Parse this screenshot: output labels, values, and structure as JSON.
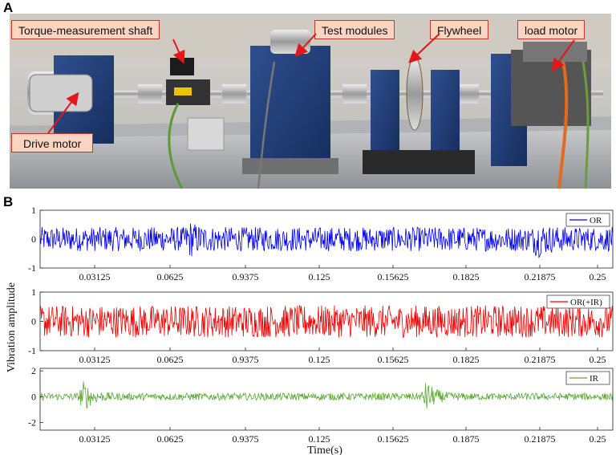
{
  "panels": {
    "a": "A",
    "b": "B"
  },
  "callouts": {
    "torque": "Torque-measurement shaft",
    "test_modules": "Test modules",
    "flywheel": "Flywheel",
    "load_motor": "load motor",
    "drive_motor": "Drive motor"
  },
  "colors": {
    "callout_fill": "#fbd5c1",
    "callout_border": "#c0392b",
    "arrow": "#e3161b",
    "or": "#0000ee",
    "or_ir": "#ee0000",
    "ir": "#5aa832"
  },
  "chart_data": [
    {
      "type": "line",
      "series": [
        {
          "name": "OR",
          "color": "#0000ee"
        }
      ],
      "ylim": [
        -1,
        1
      ],
      "yticks": [
        "1",
        "0",
        "-1"
      ],
      "xticks": [
        "0.03125",
        "0.0625",
        "0.9375",
        "0.125",
        "0.15625",
        "0.1825",
        "0.21875",
        "0.25"
      ],
      "xlim": [
        0,
        0.258
      ],
      "legend": "top-right",
      "bursts": [
        0.0675,
        0.224
      ],
      "burst_gain": 1.6,
      "base_amp": 0.42
    },
    {
      "type": "line",
      "series": [
        {
          "name": "OR(+IR)",
          "color": "#ee0000"
        }
      ],
      "ylim": [
        -1,
        1
      ],
      "yticks": [
        "1",
        "0",
        "-1"
      ],
      "xticks": [
        "0.03125",
        "0.0625",
        "0.9375",
        "0.125",
        "0.15625",
        "0.1825",
        "0.21875",
        "0.25"
      ],
      "xlim": [
        0,
        0.258
      ],
      "legend": "top-right",
      "bursts": [],
      "burst_gain": 1.0,
      "base_amp": 0.55
    },
    {
      "type": "line",
      "series": [
        {
          "name": "IR",
          "color": "#5aa832"
        }
      ],
      "ylim": [
        -2.6,
        2.2
      ],
      "yticks": [
        "2",
        "0",
        "-2"
      ],
      "xticks": [
        "0.03125",
        "0.0625",
        "0.9375",
        "0.125",
        "0.15625",
        "0.1875",
        "0.21875",
        "0.25"
      ],
      "xlim": [
        0,
        0.258
      ],
      "legend": "top-right",
      "bursts": [
        0.0195,
        0.174
      ],
      "burst_gain": 4.5,
      "base_amp": 0.28
    }
  ],
  "axes": {
    "ylabel": "Vibration amplitude",
    "xlabel": "Time(s)"
  }
}
